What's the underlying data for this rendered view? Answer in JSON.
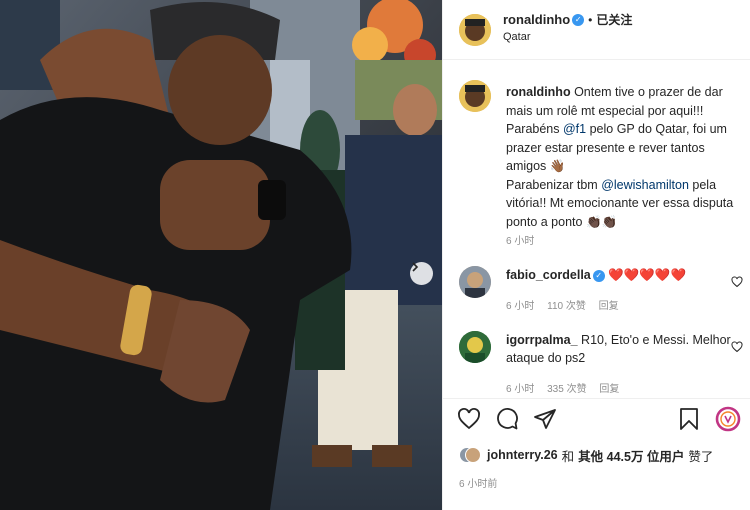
{
  "post": {
    "author": "ronaldinho",
    "follow_state": "已关注",
    "separator": "•",
    "location": "Qatar",
    "caption_parts": [
      {
        "t": "Ontem tive o prazer de dar mais um rolê mt especial por aqui!!! Parabéns ",
        "mention": false
      },
      {
        "t": "@f1",
        "mention": true
      },
      {
        "t": " pelo GP do Qatar, foi um prazer estar presente e rever tantos amigos ",
        "mention": false
      },
      {
        "t": "👋🏾",
        "mention": false
      },
      {
        "t": "\nParabenizar tbm ",
        "mention": false
      },
      {
        "t": "@lewishamilton",
        "mention": true
      },
      {
        "t": " pela vitória!! Mt emocionante ver essa disputa ponto a ponto ",
        "mention": false
      },
      {
        "t": "👏🏿👏🏿",
        "mention": false
      }
    ],
    "caption_time": "6 小时"
  },
  "comments": [
    {
      "user": "fabio_cordella",
      "verified": true,
      "text": "❤️❤️❤️❤️❤️",
      "time": "6 小时",
      "likes": "110 次赞",
      "reply": "回复",
      "avatar_color": "#c8a27a"
    },
    {
      "user": "igorrpalma_",
      "verified": false,
      "text": "R10, Eto'o e Messi. Melhor ataque do ps2",
      "time": "6 小时",
      "likes": "335 次赞",
      "reply": "回复",
      "avatar_color": "#3a7d44"
    }
  ],
  "likes": {
    "user": "johnterry.26",
    "and": "和",
    "others": "其他 44.5万 位用户",
    "liked": "赞了"
  },
  "timestamp": "6 小时前",
  "icons": [
    "heart-icon",
    "comment-icon",
    "share-icon",
    "bookmark-icon",
    "chevron-right-icon",
    "verified-icon"
  ],
  "colors": {
    "verified": "#3897f0",
    "mention": "#00376b",
    "meta_text": "#8e8e8e",
    "heart_red": "#ed4956",
    "border": "#efefef"
  }
}
